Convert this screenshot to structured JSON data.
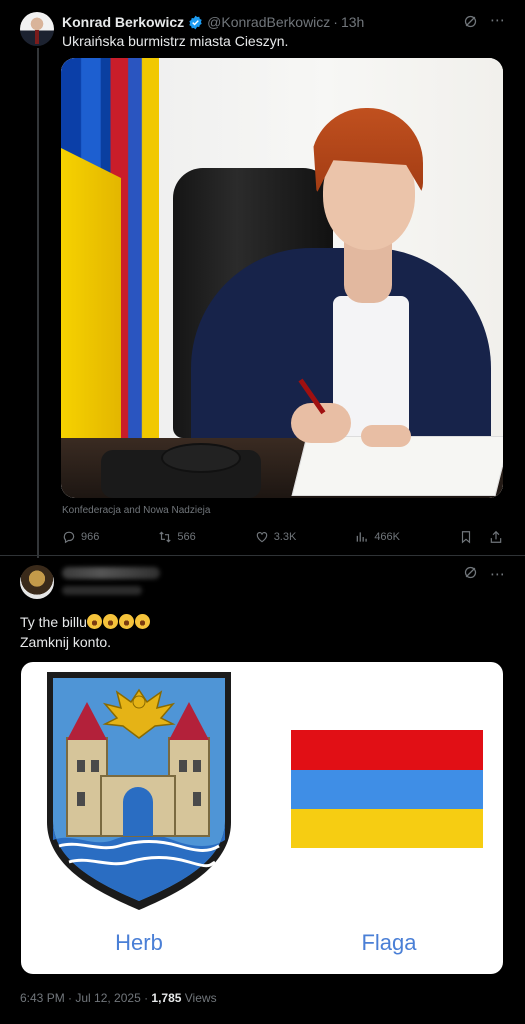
{
  "tweet1": {
    "author_name": "Konrad Berkowicz",
    "handle": "@KonradBerkowicz",
    "separator": "·",
    "time": "13h",
    "text": "Ukraińska burmistrz miasta Cieszyn.",
    "media_caption": "Konfederacja and Nowa Nadzieja",
    "actions": {
      "replies": "966",
      "reposts": "566",
      "likes": "3.3K",
      "views": "466K"
    }
  },
  "tweet2": {
    "text_line1": "Ty the billu",
    "text_line2": "Zamknij konto.",
    "emoji_name": "rolling-on-the-floor-laughing",
    "emoji_count": 4,
    "card": {
      "left_label": "Herb",
      "right_label": "Flaga",
      "flag_colors": [
        "#e10f15",
        "#3f8ee6",
        "#f6cd12"
      ]
    },
    "timestamp": "6:43 PM · Jul 12, 2025 · ",
    "views_count": "1,785",
    "views_label": " Views"
  },
  "colors": {
    "background": "#000000",
    "text_primary": "#e7e9ea",
    "text_secondary": "#71767b",
    "verified": "#1d9bf0",
    "card_label": "#4a7fd6"
  },
  "icons": [
    "grok-icon",
    "more-icon",
    "reply-icon",
    "repost-icon",
    "like-icon",
    "views-icon",
    "bookmark-icon",
    "share-icon"
  ]
}
